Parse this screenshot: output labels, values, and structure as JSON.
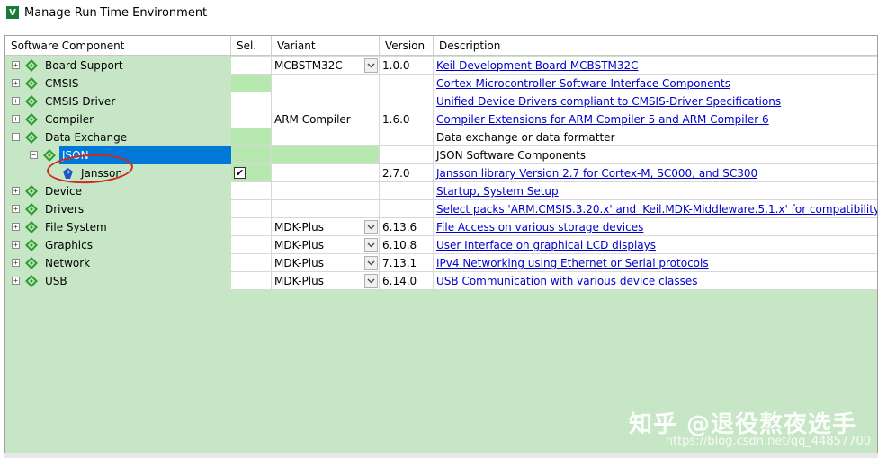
{
  "window": {
    "title": "Manage Run-Time Environment",
    "icon": "keil-v-icon"
  },
  "columns": {
    "component": "Software Component",
    "sel": "Sel.",
    "variant": "Variant",
    "version": "Version",
    "description": "Description"
  },
  "rows": [
    {
      "name": "Board Support",
      "variant": "MCBSTM32C",
      "version": "1.0.0",
      "description": "Keil Development Board MCBSTM32C",
      "link": true
    },
    {
      "name": "CMSIS",
      "variant": "",
      "version": "",
      "description": "Cortex Microcontroller Software Interface Components",
      "link": true
    },
    {
      "name": "CMSIS Driver",
      "variant": "",
      "version": "",
      "description": "Unified Device Drivers compliant to CMSIS-Driver Specifications",
      "link": true
    },
    {
      "name": "Compiler",
      "variant": "ARM Compiler",
      "version": "1.6.0",
      "description": "Compiler Extensions for ARM Compiler 5 and ARM Compiler 6",
      "link": true
    },
    {
      "name": "Data Exchange",
      "variant": "",
      "version": "",
      "description": "Data exchange or data formatter",
      "link": false
    },
    {
      "name": "JSON",
      "variant": "",
      "version": "",
      "description": "JSON Software Components",
      "link": false
    },
    {
      "name": "Jansson",
      "variant": "",
      "version": "2.7.0",
      "description": "Jansson library Version 2.7 for Cortex-M, SC000, and SC300",
      "link": true,
      "checked": "✔"
    },
    {
      "name": "Device",
      "variant": "",
      "version": "",
      "description": "Startup, System Setup",
      "link": true
    },
    {
      "name": "Drivers",
      "variant": "",
      "version": "",
      "description": "Select packs 'ARM.CMSIS.3.20.x' and 'Keil.MDK-Middleware.5.1.x' for compatibility",
      "link": true
    },
    {
      "name": "File System",
      "variant": "MDK-Plus",
      "version": "6.13.6",
      "description": "File Access on various storage devices",
      "link": true
    },
    {
      "name": "Graphics",
      "variant": "MDK-Plus",
      "version": "6.10.8",
      "description": "User Interface on graphical LCD displays",
      "link": true
    },
    {
      "name": "Network",
      "variant": "MDK-Plus",
      "version": "7.13.1",
      "description": "IPv4 Networking using Ethernet or Serial protocols",
      "link": true
    },
    {
      "name": "USB",
      "variant": "MDK-Plus",
      "version": "6.14.0",
      "description": "USB Communication with various device classes",
      "link": true
    }
  ],
  "expanders": {
    "plus": "+",
    "minus": "−"
  },
  "watermark": {
    "text": "知乎 @退役熬夜选手",
    "url": "https://blog.csdn.net/qq_44857700"
  },
  "colors": {
    "tree_bg": "#c6e6c6",
    "sel_green": "#b6e8b0",
    "diamond": "#2e9e2e",
    "selection": "#0078d7",
    "annotation": "#d0281f"
  }
}
